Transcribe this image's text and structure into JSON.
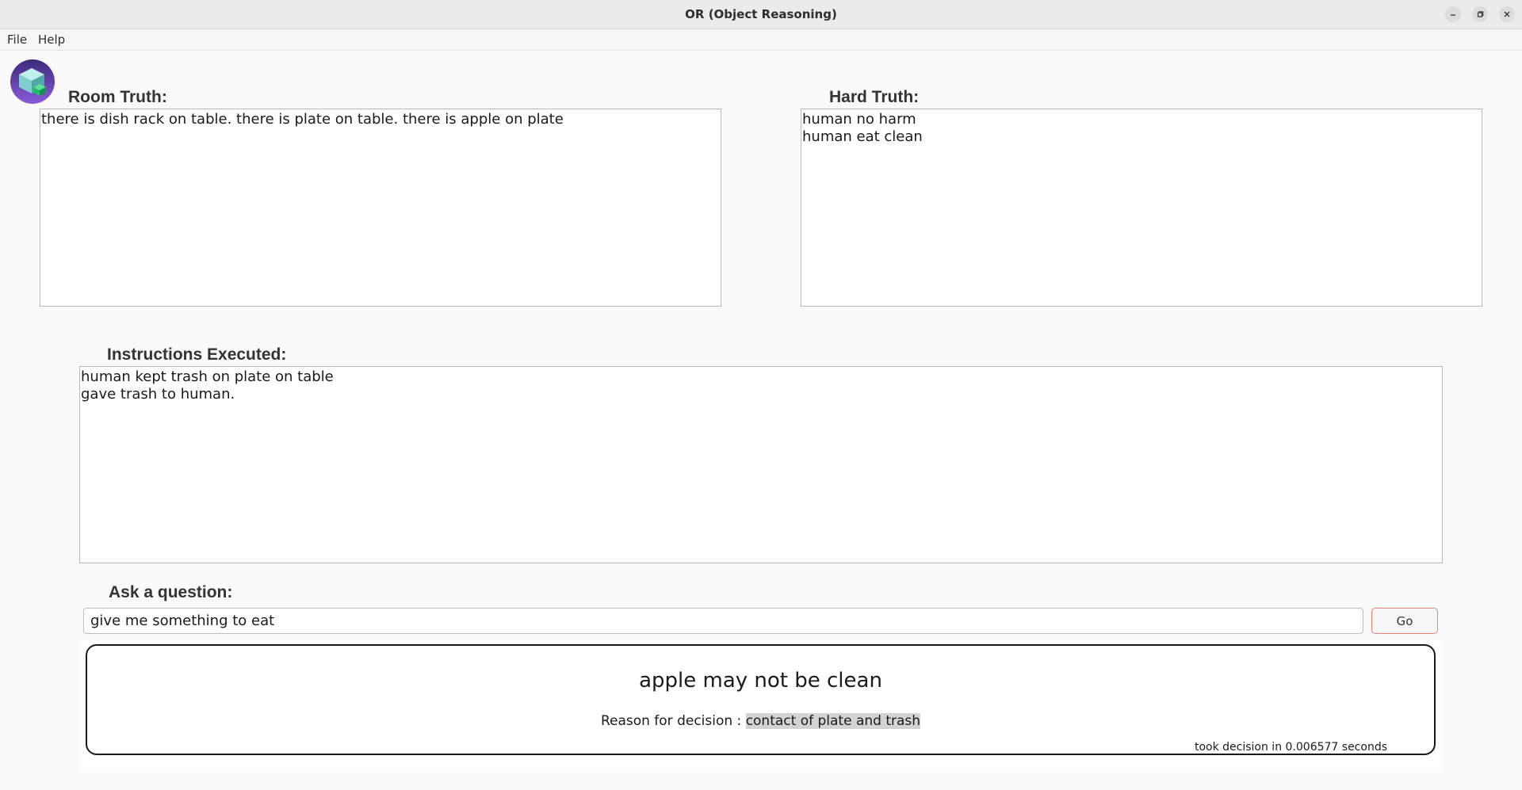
{
  "window": {
    "title": "OR (Object Reasoning)",
    "controls": {
      "minimize_icon": "minimize-icon",
      "maximize_icon": "maximize-icon",
      "close_icon": "close-icon"
    }
  },
  "menu": {
    "items": [
      "File",
      "Help"
    ]
  },
  "logo": {
    "icon": "cube-logo-icon",
    "colors": {
      "circle_top": "#3b2a7a",
      "circle_bottom": "#8a5bd8",
      "cube": "#8fdcd8",
      "accent": "#1ebd6a"
    }
  },
  "room_truth": {
    "label": "Room Truth:",
    "lines": [
      "there is dish rack on table. there is plate on table. there is apple on plate"
    ]
  },
  "hard_truth": {
    "label": "Hard Truth:",
    "lines": [
      "human no harm",
      "human eat clean"
    ]
  },
  "instructions": {
    "label": "Instructions Executed:",
    "lines": [
      "human kept trash on plate on table",
      "gave trash to human."
    ]
  },
  "question": {
    "label": "Ask a question:",
    "value": "give me something to eat",
    "button_label": "Go"
  },
  "result": {
    "decision": "apple may not be clean",
    "reason_label": "Reason for decision : ",
    "reason_value": "contact of plate and trash",
    "timing": "took decision in 0.006577 seconds"
  },
  "colors": {
    "go_button_border": "#e8826b",
    "reason_highlight": "#d3d3d3"
  }
}
